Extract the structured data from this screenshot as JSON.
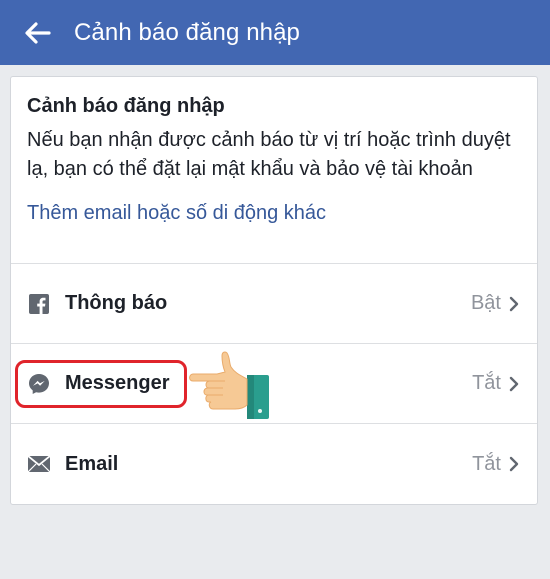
{
  "header": {
    "title": "Cảnh báo đăng nhập"
  },
  "intro": {
    "title": "Cảnh báo đăng nhập",
    "description": "Nếu bạn nhận được cảnh báo từ vị trí hoặc trình duyệt lạ, bạn có thể đặt lại mật khẩu và bảo vệ tài khoản",
    "link": "Thêm email hoặc số di động khác"
  },
  "rows": [
    {
      "label": "Thông báo",
      "value": "Bật",
      "icon": "facebook-icon"
    },
    {
      "label": "Messenger",
      "value": "Tắt",
      "icon": "messenger-icon"
    },
    {
      "label": "Email",
      "value": "Tắt",
      "icon": "envelope-icon"
    }
  ],
  "colors": {
    "header_bg": "#4267b2",
    "link": "#365899",
    "highlight": "#e0242b",
    "page_bg": "#e9ebee"
  }
}
